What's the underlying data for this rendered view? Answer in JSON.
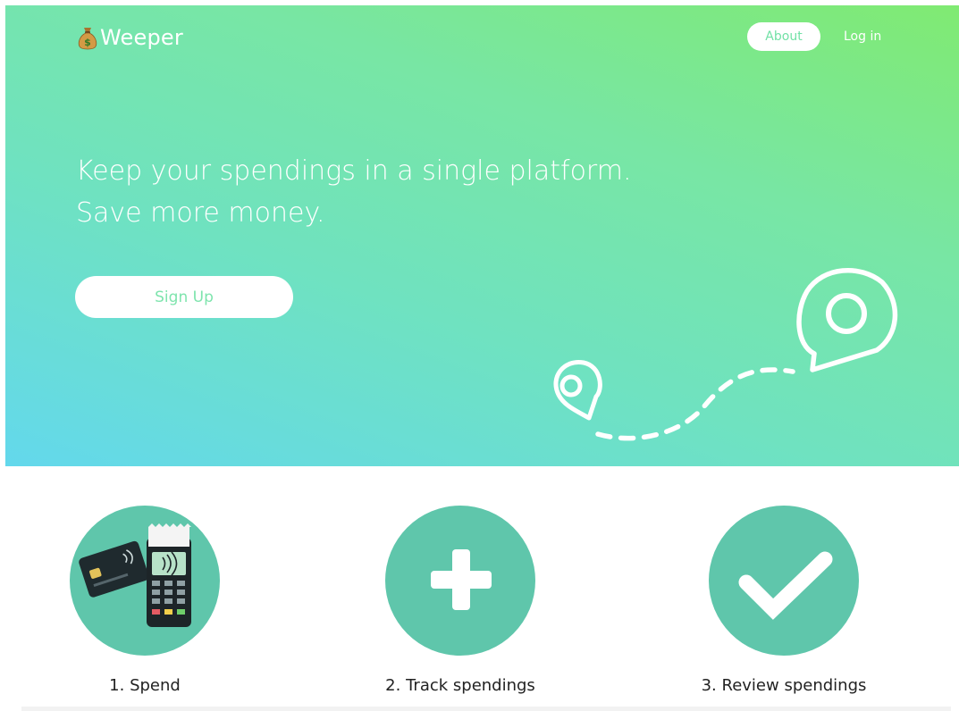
{
  "header": {
    "brand_name": "Weeper",
    "brand_icon": "money-bag-icon",
    "nav": {
      "about_label": "About",
      "login_label": "Log in"
    }
  },
  "hero": {
    "headline_line1": "Keep your spendings in a single platform.",
    "headline_line2": "Save more money.",
    "signup_label": "Sign Up",
    "illustration": "map-route-pins-icon"
  },
  "steps": [
    {
      "label": "1. Spend",
      "icon": "card-payment-terminal-icon"
    },
    {
      "label": "2. Track spendings",
      "icon": "plus-icon"
    },
    {
      "label": "3. Review spendings",
      "icon": "checkmark-icon"
    }
  ],
  "colors": {
    "gradient_start": "#63d8ec",
    "gradient_end": "#80ea72",
    "accent_teal": "#5fc6ab",
    "button_text": "#72e1a6"
  }
}
